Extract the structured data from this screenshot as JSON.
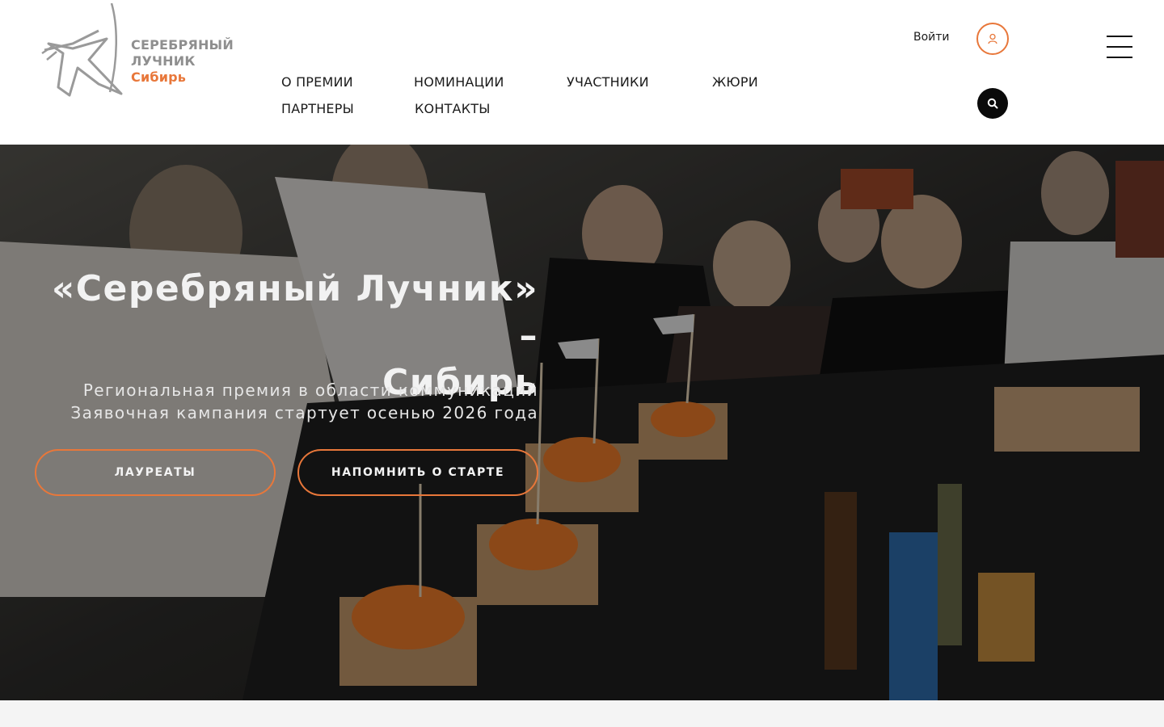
{
  "header": {
    "logo": {
      "line1": "СЕРЕБРЯНЫЙ",
      "line2": "ЛУЧНИК",
      "line3": "Сибирь"
    },
    "nav": [
      {
        "label": "О ПРЕМИИ"
      },
      {
        "label": "НОМИНАЦИИ"
      },
      {
        "label": "УЧАСТНИКИ"
      },
      {
        "label": "ЖЮРИ"
      },
      {
        "label": "ПАРТНЕРЫ"
      },
      {
        "label": "КОНТАКТЫ"
      }
    ],
    "login_label": "Войти",
    "icons": {
      "user": "user-icon",
      "search": "search-icon",
      "menu": "hamburger-menu-icon"
    }
  },
  "hero": {
    "title_line1": "«Серебряный Лучник» –",
    "title_line2": "Сибирь",
    "subtitle_line1": "Региональная премия в области коммуникаций",
    "subtitle_line2": "Заявочная кампания стартует осенью 2026 года",
    "buttons": {
      "laureates": "ЛАУРЕАТЫ",
      "remind": "НАПОМНИТЬ О СТАРТЕ"
    }
  },
  "colors": {
    "accent": "#e8773a",
    "dark": "#0a0a0a",
    "logo_gray": "#8f8f8f"
  }
}
